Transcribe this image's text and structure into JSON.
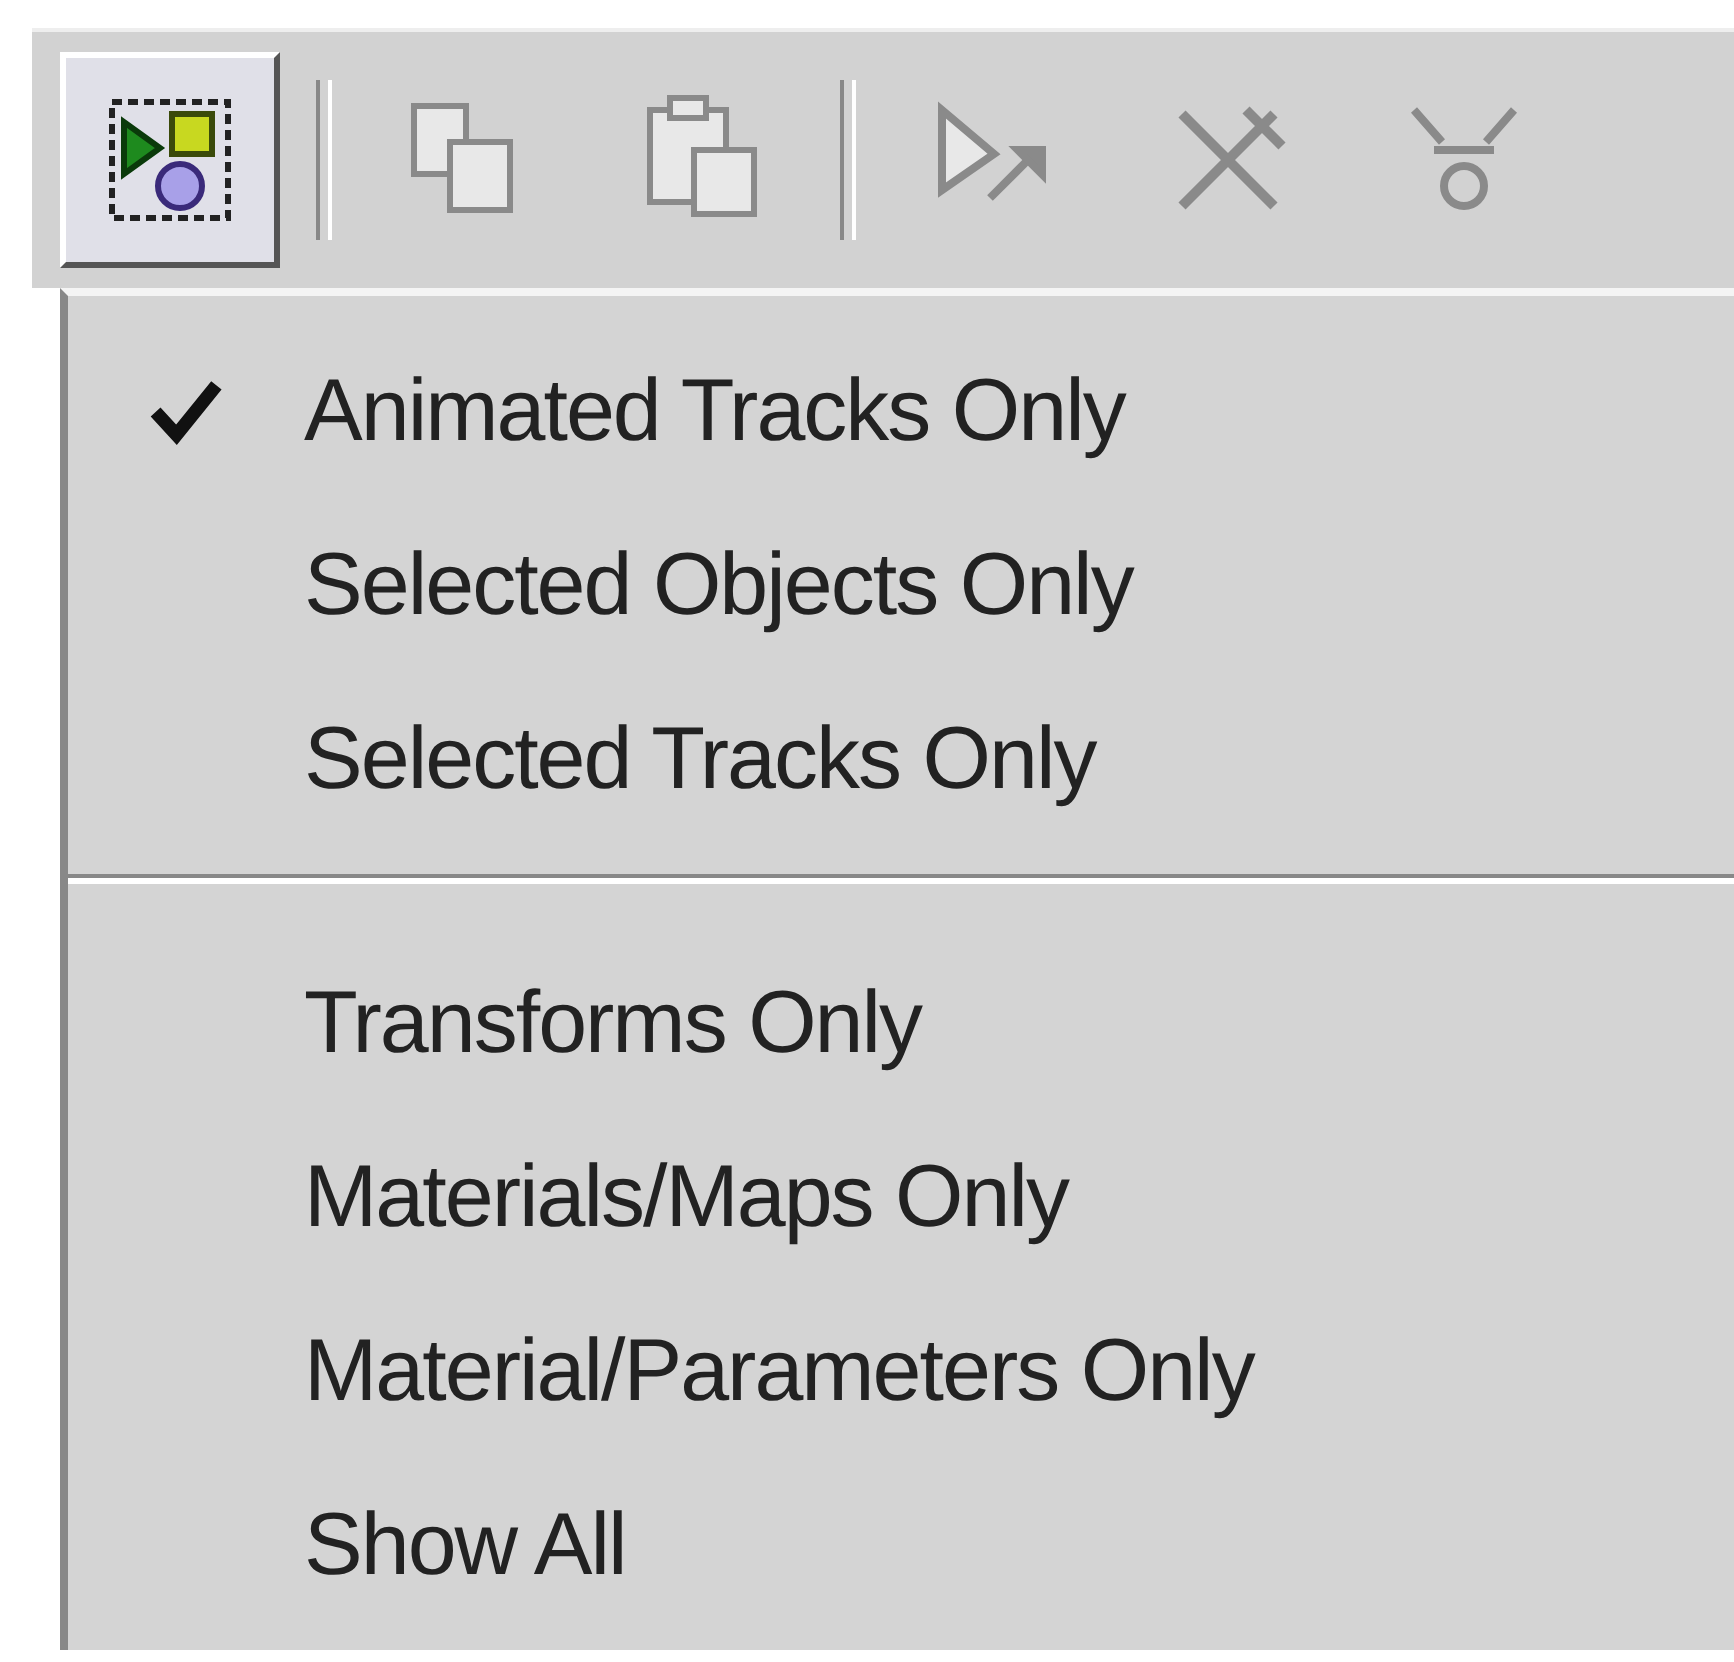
{
  "toolbar": {
    "items": [
      {
        "kind": "button",
        "pressed": true,
        "disabled": false
      },
      {
        "kind": "separator"
      },
      {
        "kind": "button",
        "pressed": false,
        "disabled": true
      },
      {
        "kind": "button",
        "pressed": false,
        "disabled": true
      },
      {
        "kind": "separator"
      },
      {
        "kind": "button",
        "pressed": false,
        "disabled": true
      },
      {
        "kind": "button",
        "pressed": false,
        "disabled": true
      },
      {
        "kind": "button",
        "pressed": false,
        "disabled": true
      }
    ]
  },
  "menu": {
    "items": [
      {
        "kind": "item",
        "label": "Animated Tracks Only",
        "checked": true
      },
      {
        "kind": "item",
        "label": "Selected Objects Only",
        "checked": false
      },
      {
        "kind": "item",
        "label": "Selected Tracks Only",
        "checked": false
      },
      {
        "kind": "separator"
      },
      {
        "kind": "item",
        "label": "Transforms Only",
        "checked": false
      },
      {
        "kind": "item",
        "label": "Materials/Maps Only",
        "checked": false
      },
      {
        "kind": "item",
        "label": "Material/Parameters Only",
        "checked": false
      },
      {
        "kind": "item",
        "label": "Show All",
        "checked": false
      }
    ]
  }
}
